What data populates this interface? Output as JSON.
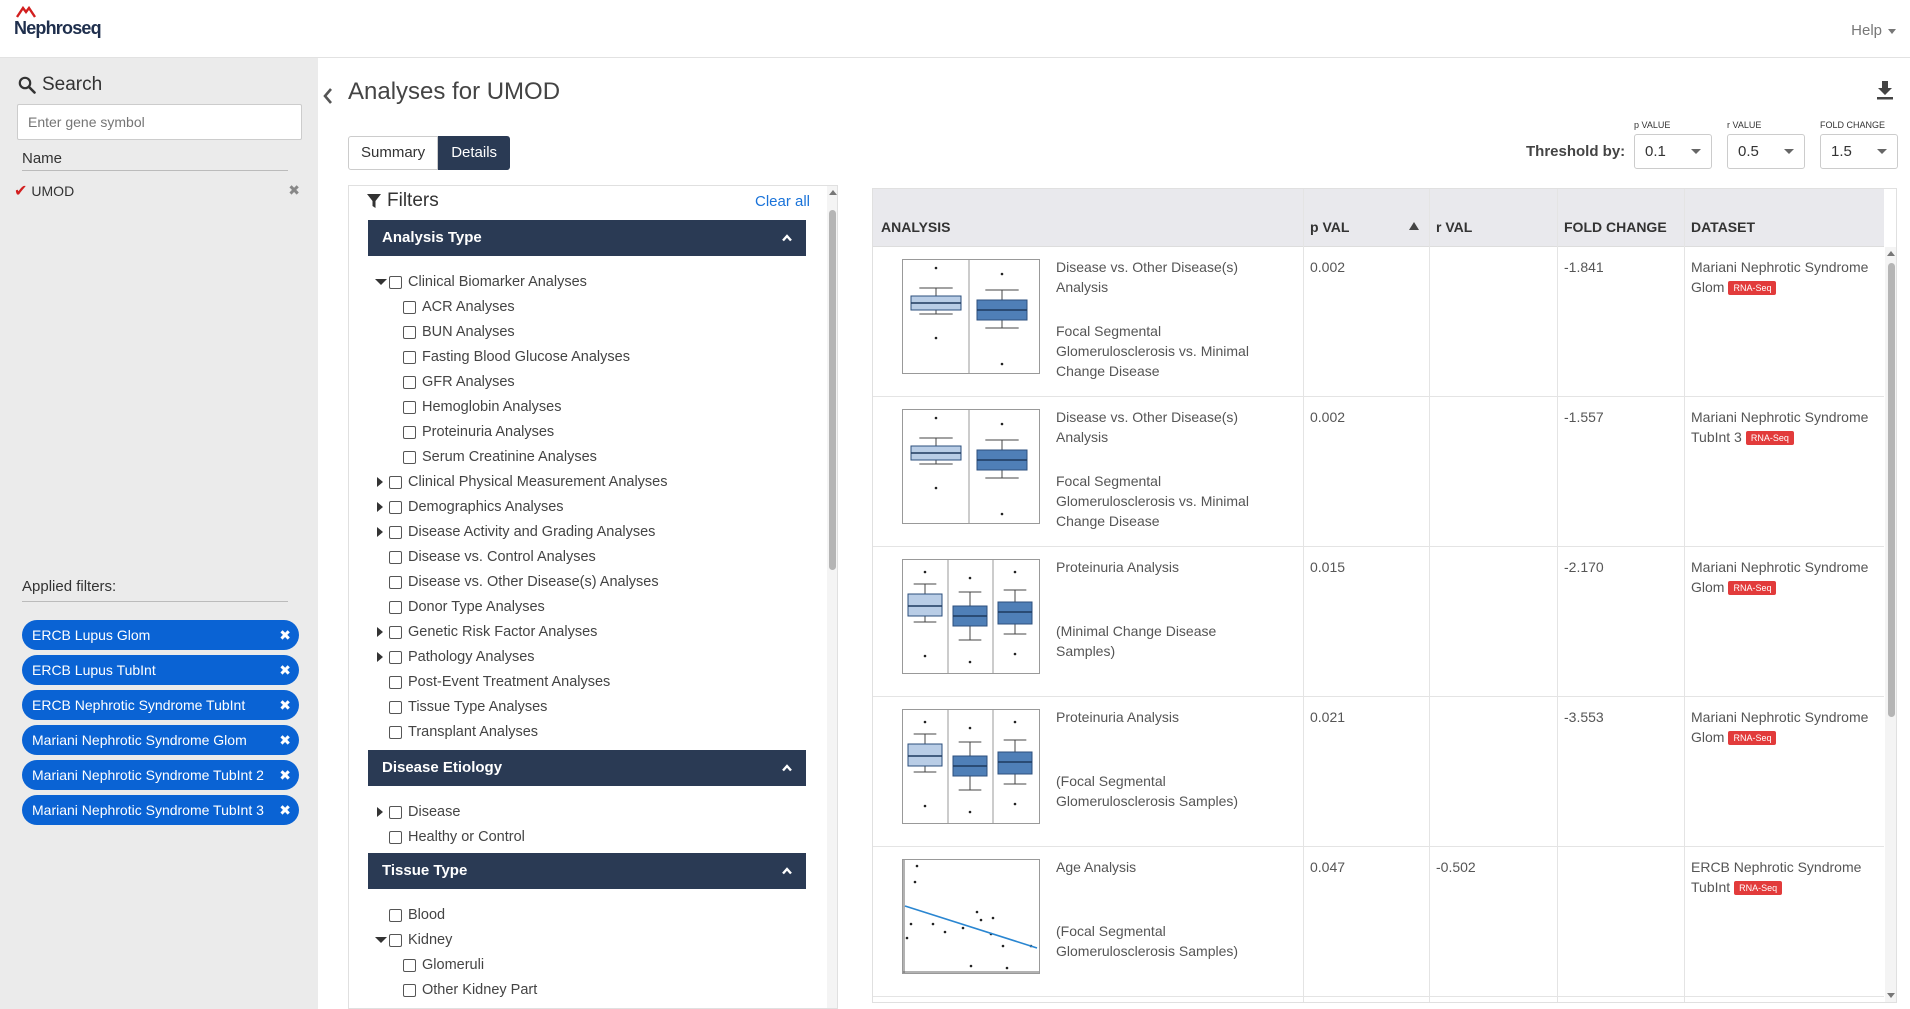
{
  "brand": {
    "name": "Nephroseq",
    "accent": "#d21f1f",
    "navy": "#2a3a54",
    "chip_blue": "#0a63d4",
    "badge_red": "#e23b3b"
  },
  "topbar": {
    "help_label": "Help"
  },
  "sidebar": {
    "search_title": "Search",
    "search_placeholder": "Enter gene symbol",
    "name_header": "Name",
    "genes": [
      {
        "label": "UMOD"
      }
    ],
    "applied_filters_title": "Applied filters:",
    "applied_filters": [
      {
        "label": "ERCB Lupus Glom"
      },
      {
        "label": "ERCB Lupus TubInt"
      },
      {
        "label": "ERCB Nephrotic Syndrome TubInt"
      },
      {
        "label": "Mariani Nephrotic Syndrome Glom"
      },
      {
        "label": "Mariani Nephrotic Syndrome TubInt 2"
      },
      {
        "label": "Mariani Nephrotic Syndrome TubInt 3"
      }
    ]
  },
  "main": {
    "title": "Analyses for UMOD",
    "tabs": [
      {
        "label": "Summary"
      },
      {
        "label": "Details"
      }
    ],
    "active_tab": "Details",
    "threshold": {
      "label": "Threshold by:",
      "p": {
        "caption": "p VALUE",
        "value": "0.1"
      },
      "r": {
        "caption": "r VALUE",
        "value": "0.5"
      },
      "fold": {
        "caption": "FOLD CHANGE",
        "value": "1.5"
      }
    }
  },
  "filters": {
    "title": "Filters",
    "clear_all": "Clear all",
    "sections": [
      {
        "title": "Analysis Type",
        "items": [
          {
            "label": "Clinical Biomarker Analyses"
          },
          {
            "label": "ACR Analyses"
          },
          {
            "label": "BUN Analyses"
          },
          {
            "label": "Fasting Blood Glucose Analyses"
          },
          {
            "label": "GFR Analyses"
          },
          {
            "label": "Hemoglobin Analyses"
          },
          {
            "label": "Proteinuria Analyses"
          },
          {
            "label": "Serum Creatinine Analyses"
          },
          {
            "label": "Clinical Physical Measurement Analyses"
          },
          {
            "label": "Demographics Analyses"
          },
          {
            "label": "Disease Activity and Grading Analyses"
          },
          {
            "label": "Disease vs. Control Analyses"
          },
          {
            "label": "Disease vs. Other Disease(s) Analyses"
          },
          {
            "label": "Donor Type Analyses"
          },
          {
            "label": "Genetic Risk Factor Analyses"
          },
          {
            "label": "Pathology Analyses"
          },
          {
            "label": "Post-Event Treatment Analyses"
          },
          {
            "label": "Tissue Type Analyses"
          },
          {
            "label": "Transplant Analyses"
          }
        ]
      },
      {
        "title": "Disease Etiology",
        "items": [
          {
            "label": "Disease"
          },
          {
            "label": "Healthy or Control"
          }
        ]
      },
      {
        "title": "Tissue Type",
        "items": [
          {
            "label": "Blood"
          },
          {
            "label": "Kidney"
          },
          {
            "label": "Glomeruli"
          },
          {
            "label": "Other Kidney Part"
          }
        ]
      }
    ]
  },
  "table": {
    "headers": {
      "analysis": "ANALYSIS",
      "pval": "p VAL",
      "rval": "r VAL",
      "fold": "FOLD CHANGE",
      "dataset": "DATASET"
    },
    "rows": [
      {
        "name": "Disease vs. Other Disease(s) Analysis",
        "sub": "Focal Segmental Glomerulosclerosis vs. Minimal Change Disease",
        "pval": "0.002",
        "rval": "",
        "fold": "-1.841",
        "dataset": "Mariani Nephrotic Syndrome Glom",
        "badge": "RNA-Seq",
        "plot": "box2"
      },
      {
        "name": "Disease vs. Other Disease(s) Analysis",
        "sub": "Focal Segmental Glomerulosclerosis vs. Minimal Change Disease",
        "pval": "0.002",
        "rval": "",
        "fold": "-1.557",
        "dataset": "Mariani Nephrotic Syndrome TubInt 3",
        "badge": "RNA-Seq",
        "plot": "box2"
      },
      {
        "name": "Proteinuria Analysis",
        "sub": "(Minimal Change Disease Samples)",
        "pval": "0.015",
        "rval": "",
        "fold": "-2.170",
        "dataset": "Mariani Nephrotic Syndrome Glom",
        "badge": "RNA-Seq",
        "plot": "box3"
      },
      {
        "name": "Proteinuria Analysis",
        "sub": "(Focal Segmental Glomerulosclerosis Samples)",
        "pval": "0.021",
        "rval": "",
        "fold": "-3.553",
        "dataset": "Mariani Nephrotic Syndrome Glom",
        "badge": "RNA-Seq",
        "plot": "box3"
      },
      {
        "name": "Age Analysis",
        "sub": "(Focal Segmental Glomerulosclerosis Samples)",
        "pval": "0.047",
        "rval": "-0.502",
        "fold": "",
        "dataset": "ERCB Nephrotic Syndrome TubInt",
        "badge": "RNA-Seq",
        "plot": "scatter"
      }
    ]
  }
}
